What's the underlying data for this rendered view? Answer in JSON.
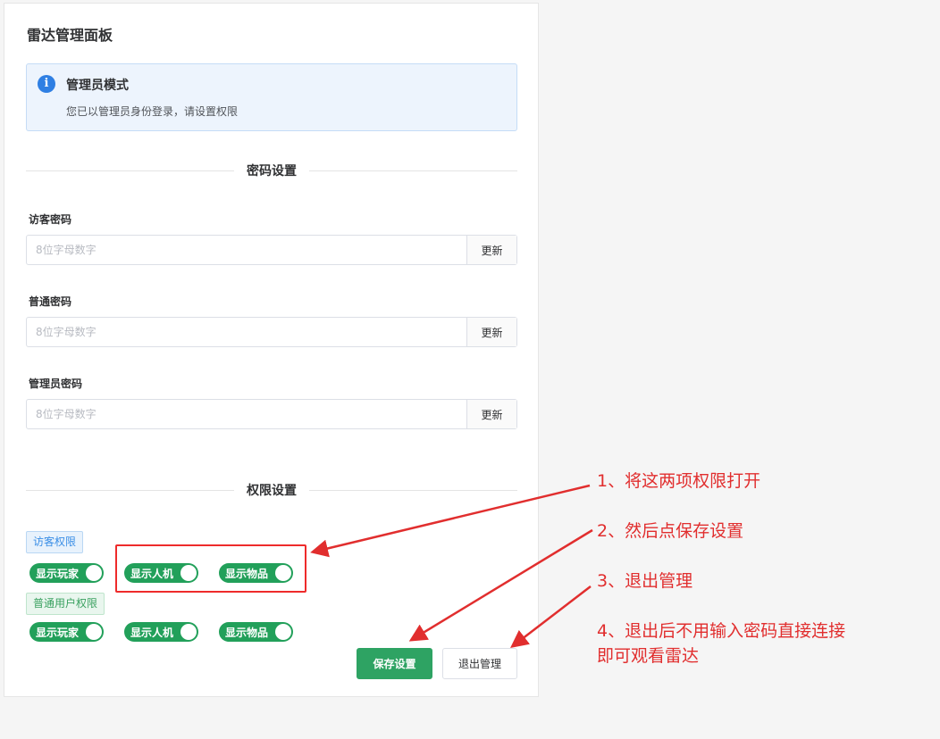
{
  "panel": {
    "title": "雷达管理面板"
  },
  "alert": {
    "title": "管理员模式",
    "description": "您已以管理员身份登录，请设置权限",
    "icon": "info-icon"
  },
  "password_section": {
    "title": "密码设置",
    "fields": [
      {
        "label": "访客密码",
        "placeholder": "8位字母数字",
        "value": "",
        "button": "更新"
      },
      {
        "label": "普通密码",
        "placeholder": "8位字母数字",
        "value": "",
        "button": "更新"
      },
      {
        "label": "管理员密码",
        "placeholder": "8位字母数字",
        "value": "",
        "button": "更新"
      }
    ]
  },
  "permission_section": {
    "title": "权限设置",
    "guest": {
      "tag": "访客权限",
      "switches": [
        {
          "label": "显示玩家",
          "on": true
        },
        {
          "label": "显示人机",
          "on": true
        },
        {
          "label": "显示物品",
          "on": true
        }
      ]
    },
    "normal": {
      "tag": "普通用户权限",
      "switches": [
        {
          "label": "显示玩家",
          "on": true
        },
        {
          "label": "显示人机",
          "on": true
        },
        {
          "label": "显示物品",
          "on": true
        }
      ]
    }
  },
  "actions": {
    "save": "保存设置",
    "exit": "退出管理"
  },
  "annotations": [
    "1、将这两项权限打开",
    "2、然后点保存设置",
    "3、退出管理",
    "4、退出后不用输入密码直接连接",
    "即可观看雷达"
  ],
  "colors": {
    "switch_on": "#22a05a",
    "annotation": "#e12e2e",
    "info": "#2f7fe3"
  }
}
